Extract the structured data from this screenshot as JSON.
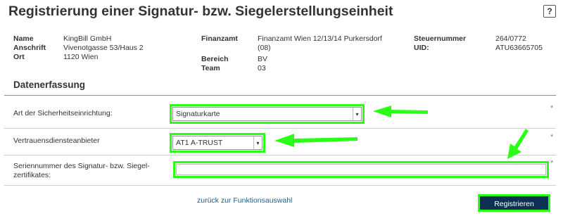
{
  "header": {
    "title": "Registrierung einer Signatur- bzw. Siegelerstellungseinheit",
    "help_label": "?"
  },
  "info": {
    "name_label": "Name",
    "name_value": "KingBill GmbH",
    "address_label": "Anschrift",
    "address_value": "Vivenotgasse 53/Haus 2",
    "city_label": "Ort",
    "city_value": "1120 Wien",
    "tax_office_label": "Finanzamt",
    "tax_office_value_line1": "Finanzamt Wien 12/13/14 Purkersdorf",
    "tax_office_value_line2": "(08)",
    "area_label": "Bereich",
    "area_value": "BV",
    "team_label": "Team",
    "team_value": "03",
    "tax_number_label": "Steuernummer",
    "tax_number_value": "264/0772",
    "uid_label": "UID:",
    "uid_value": "ATU63665705"
  },
  "form": {
    "section_title": "Datenerfassung",
    "security_label": "Art der Sicherheitseinrichtung:",
    "security_value": "Signaturkarte",
    "provider_label": "Vertrauensdiensteanbieter",
    "provider_value": "AT1 A-TRUST",
    "serial_label_line1": "Seriennummer des Signatur- bzw. Siegel-",
    "serial_label_line2": "zertifikates:",
    "serial_value": "",
    "required_mark": "*",
    "chevron": "▾"
  },
  "footer": {
    "back_link": "zurück zur Funktionsauswahl",
    "submit_label": "Registrieren"
  },
  "colors": {
    "highlight": "#2bff17",
    "button_bg": "#0d3152",
    "link": "#1f5c8a"
  }
}
